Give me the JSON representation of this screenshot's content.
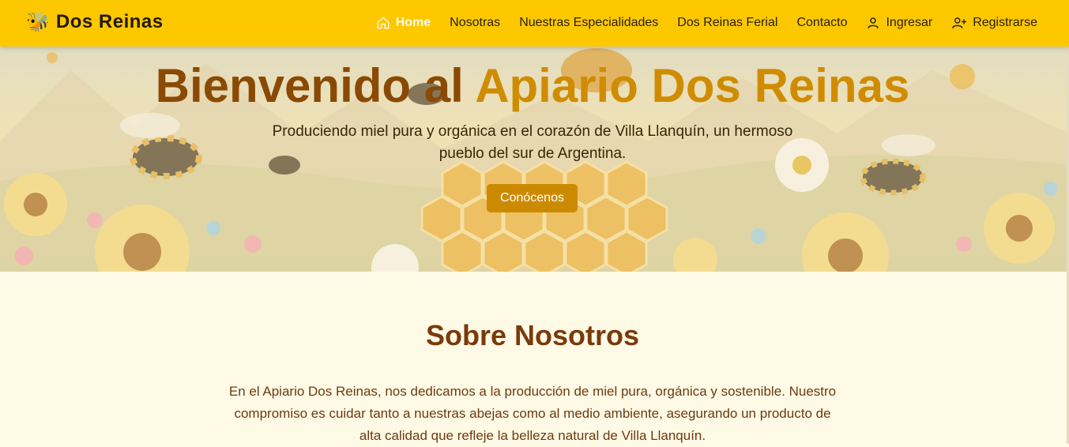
{
  "navbar": {
    "brand_emoji": "🐝",
    "brand_name": "Dos Reinas",
    "links": [
      {
        "label": "Home",
        "icon": "home-icon",
        "active": true
      },
      {
        "label": "Nosotras"
      },
      {
        "label": "Nuestras Especialidades"
      },
      {
        "label": "Dos Reinas Ferial"
      },
      {
        "label": "Contacto"
      },
      {
        "label": "Ingresar",
        "icon": "user-icon"
      },
      {
        "label": "Registrarse",
        "icon": "user-plus-icon"
      }
    ]
  },
  "hero": {
    "title_part1": "Bienvenido al ",
    "title_part2": "Apiario Dos Reinas",
    "subtitle": "Produciendo miel pura y orgánica en el corazón de Villa Llanquín, un hermoso pueblo del sur de Argentina.",
    "button_label": "Conócenos"
  },
  "about": {
    "title": "Sobre Nosotros",
    "text": "En el Apiario Dos Reinas, nos dedicamos a la producción de miel pura, orgánica y sostenible. Nuestro compromiso es cuidar tanto a nuestras abejas como al medio ambiente, asegurando un producto de alta calidad que refleje la belleza natural de Villa Llanquín."
  },
  "colors": {
    "navbar_bg": "#fdc800",
    "accent": "#d08c00",
    "button": "#cc8a00",
    "page_bg": "#fffae6"
  }
}
